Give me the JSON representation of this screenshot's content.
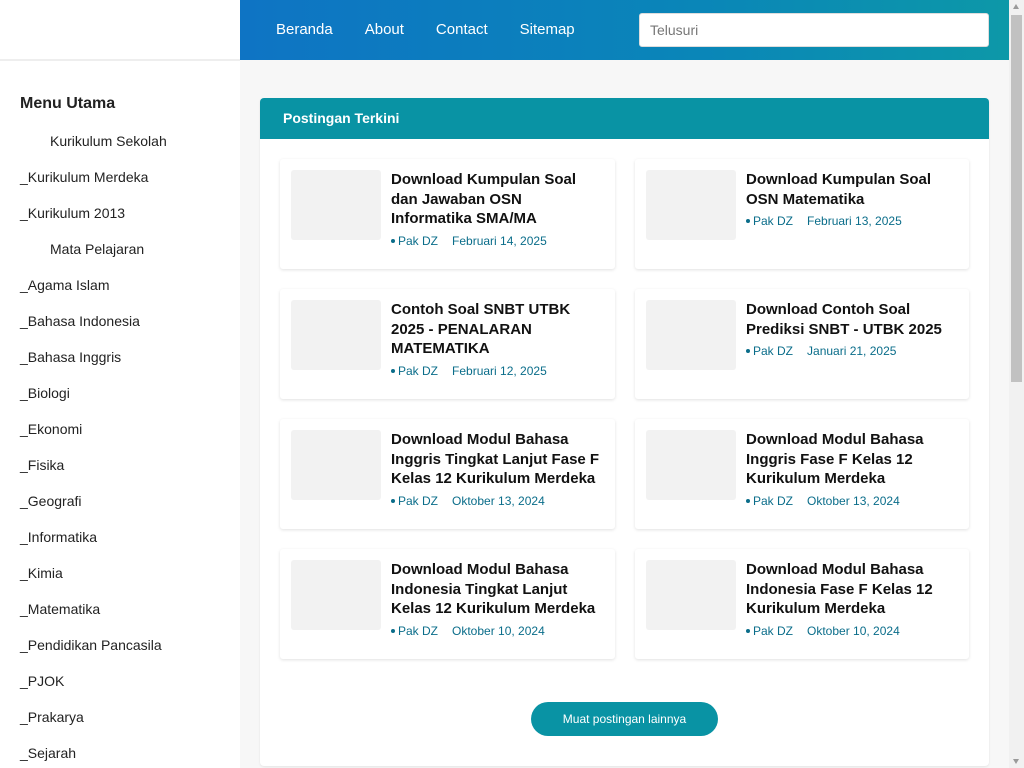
{
  "nav": {
    "links": [
      "Beranda",
      "About",
      "Contact",
      "Sitemap"
    ],
    "search_placeholder": "Telusuri"
  },
  "sidebar": {
    "title": "Menu Utama",
    "items": [
      {
        "label": "Kurikulum Sekolah",
        "sub": true
      },
      {
        "label": "_Kurikulum Merdeka",
        "sub": false
      },
      {
        "label": "_Kurikulum 2013",
        "sub": false
      },
      {
        "label": "Mata Pelajaran",
        "sub": true
      },
      {
        "label": "_Agama Islam",
        "sub": false
      },
      {
        "label": "_Bahasa Indonesia",
        "sub": false
      },
      {
        "label": "_Bahasa Inggris",
        "sub": false
      },
      {
        "label": "_Biologi",
        "sub": false
      },
      {
        "label": "_Ekonomi",
        "sub": false
      },
      {
        "label": "_Fisika",
        "sub": false
      },
      {
        "label": "_Geografi",
        "sub": false
      },
      {
        "label": "_Informatika",
        "sub": false
      },
      {
        "label": "_Kimia",
        "sub": false
      },
      {
        "label": "_Matematika",
        "sub": false
      },
      {
        "label": "_Pendidikan Pancasila",
        "sub": false
      },
      {
        "label": "_PJOK",
        "sub": false
      },
      {
        "label": "_Prakarya",
        "sub": false
      },
      {
        "label": "_Sejarah",
        "sub": false
      }
    ]
  },
  "main": {
    "header": "Postingan Terkini",
    "posts": [
      {
        "title": "Download Kumpulan Soal dan Jawaban OSN Informatika SMA/MA",
        "author": "Pak DZ",
        "date": "Februari 14, 2025"
      },
      {
        "title": "Download Kumpulan Soal OSN Matematika",
        "author": "Pak DZ",
        "date": "Februari 13, 2025"
      },
      {
        "title": "Contoh Soal SNBT UTBK 2025 - PENALARAN MATEMATIKA",
        "author": "Pak DZ",
        "date": "Februari 12, 2025"
      },
      {
        "title": "Download Contoh Soal Prediksi SNBT - UTBK 2025",
        "author": "Pak DZ",
        "date": "Januari 21, 2025"
      },
      {
        "title": "Download Modul Bahasa Inggris Tingkat Lanjut Fase F Kelas 12 Kurikulum Merdeka",
        "author": "Pak DZ",
        "date": "Oktober 13, 2024"
      },
      {
        "title": "Download Modul Bahasa Inggris Fase F Kelas 12 Kurikulum Merdeka",
        "author": "Pak DZ",
        "date": "Oktober 13, 2024"
      },
      {
        "title": "Download Modul Bahasa Indonesia Tingkat Lanjut Kelas 12 Kurikulum Merdeka",
        "author": "Pak DZ",
        "date": "Oktober 10, 2024"
      },
      {
        "title": "Download Modul Bahasa Indonesia Fase F Kelas 12 Kurikulum Merdeka",
        "author": "Pak DZ",
        "date": "Oktober 10, 2024"
      }
    ],
    "load_more_label": "Muat postingan lainnya"
  },
  "colors": {
    "accent": "#0993a4",
    "nav_start": "#0e74c4",
    "nav_end": "#0d98a8",
    "meta_text": "#0a6d8a"
  }
}
